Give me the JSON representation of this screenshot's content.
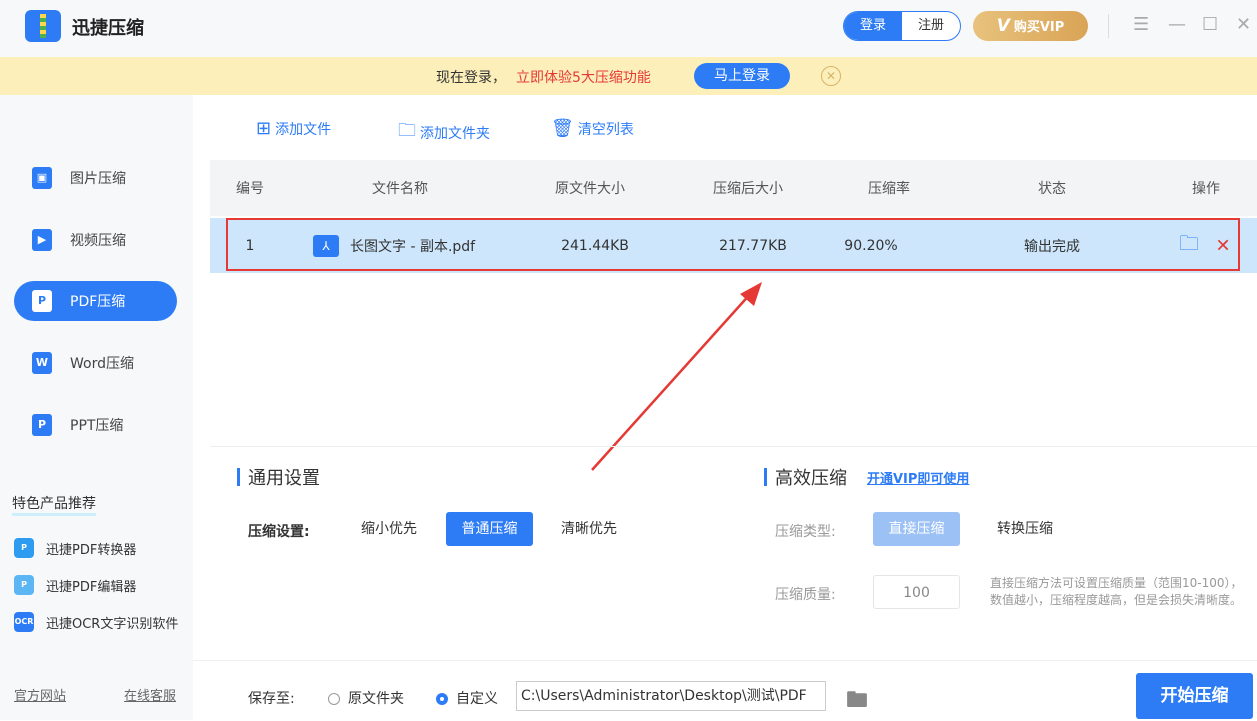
{
  "app": {
    "title": "迅捷压缩",
    "login": "登录",
    "register": "注册",
    "vip": "购买VIP",
    "vip_icon": "V"
  },
  "banner": {
    "text": "现在登录，",
    "highlight": "立即体验5大压缩功能",
    "button": "马上登录"
  },
  "sidebar": {
    "items": [
      {
        "label": "图片压缩",
        "icon": "image-icon"
      },
      {
        "label": "视频压缩",
        "icon": "video-icon"
      },
      {
        "label": "PDF压缩",
        "icon": "pdf-icon"
      },
      {
        "label": "Word压缩",
        "icon": "word-icon"
      },
      {
        "label": "PPT压缩",
        "icon": "ppt-icon"
      }
    ],
    "featured_title": "特色产品推荐",
    "products": [
      {
        "label": "迅捷PDF转换器"
      },
      {
        "label": "迅捷PDF编辑器"
      },
      {
        "label": "迅捷OCR文字识别软件"
      }
    ],
    "footer": {
      "website": "官方网站",
      "support": "在线客服"
    }
  },
  "toolbar": {
    "add_file": "添加文件",
    "add_folder": "添加文件夹",
    "clear": "清空列表"
  },
  "table": {
    "headers": [
      "编号",
      "文件名称",
      "原文件大小",
      "压缩后大小",
      "压缩率",
      "状态",
      "操作"
    ],
    "rows": [
      {
        "index": "1",
        "name": "长图文字 - 副本.pdf",
        "original": "241.44KB",
        "compressed": "217.77KB",
        "ratio": "90.20%",
        "status": "输出完成"
      }
    ]
  },
  "general": {
    "title": "通用设置",
    "label": "压缩设置:",
    "options": [
      "缩小优先",
      "普通压缩",
      "清晰优先"
    ],
    "selected": "普通压缩"
  },
  "advanced": {
    "title": "高效压缩",
    "vip_link": "开通VIP即可使用",
    "type_label": "压缩类型:",
    "types": [
      "直接压缩",
      "转换压缩"
    ],
    "quality_label": "压缩质量:",
    "quality": "100",
    "hint1": "直接压缩方法可设置压缩质量（范围10-100），",
    "hint2": "数值越小，压缩程度越高，但是会损失清晰度。"
  },
  "output": {
    "label": "保存至:",
    "opt1": "原文件夹",
    "opt2": "自定义",
    "path": "C:\\Users\\Administrator\\Desktop\\测试\\PDF",
    "start": "开始压缩"
  },
  "colors": {
    "accent": "#2d7cf6",
    "highlight_border": "#e53935"
  }
}
